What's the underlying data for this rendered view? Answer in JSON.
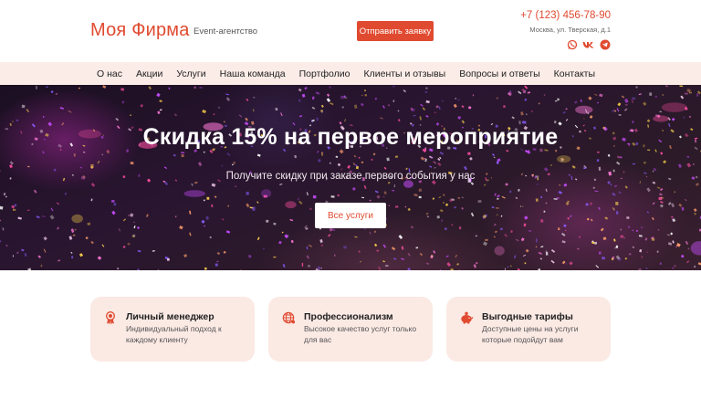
{
  "header": {
    "logo": "Моя Фирма",
    "tagline": "Event-агентство",
    "cta_label": "Отправить заявку",
    "phone": "+7 (123) 456-78-90",
    "address": "Москва, ул. Тверская, д.1",
    "socials": [
      "whatsapp-icon",
      "vk-icon",
      "telegram-icon"
    ]
  },
  "nav": {
    "items": [
      "О нас",
      "Акции",
      "Услуги",
      "Наша команда",
      "Портфолио",
      "Клиенты и отзывы",
      "Вопросы и ответы",
      "Контакты"
    ]
  },
  "hero": {
    "title": "Скидка 15% на первое мероприятие",
    "subtitle": "Получите скидку при заказе первого события у нас",
    "button_label": "Все услуги"
  },
  "features": [
    {
      "icon": "award-icon",
      "title": "Личный менеджер",
      "text": "Индивидуальный подход к каждому клиенту"
    },
    {
      "icon": "globe-network-icon",
      "title": "Профессионализм",
      "text": "Высокое качество услуг только для вас"
    },
    {
      "icon": "piggy-bank-icon",
      "title": "Выгодные тарифы",
      "text": "Доступные цены на услуги которые подойдут вам"
    }
  ],
  "colors": {
    "accent": "#e04a30",
    "nav_bg": "#fbece7",
    "card_bg": "#fbe9e4"
  }
}
